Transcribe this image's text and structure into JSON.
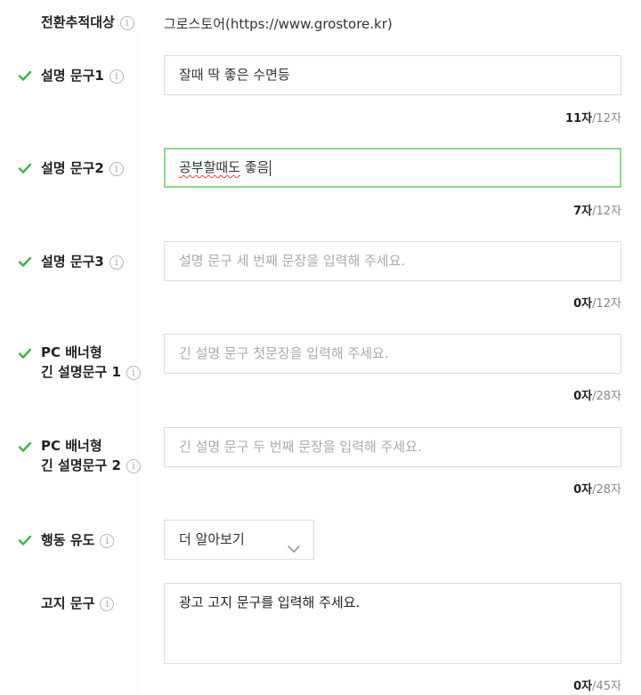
{
  "conversion": {
    "label": "전환추적대상",
    "value": "그로스토어(https://www.grostore.kr)"
  },
  "desc1": {
    "label": "설명 문구1",
    "value": "잘때 딱 좋은 수면등",
    "counter_current": "11자",
    "counter_max": "/12자"
  },
  "desc2": {
    "label": "설명 문구2",
    "value_part1": "공부할때도",
    "value_part2": " 좋음",
    "counter_current": "7자",
    "counter_max": "/12자"
  },
  "desc3": {
    "label": "설명 문구3",
    "placeholder": "설명 문구 세 번째 문장을 입력해 주세요.",
    "counter_current": "0자",
    "counter_max": "/12자"
  },
  "pc_long1": {
    "label_line1": "PC 배너형",
    "label_line2": "긴 설명문구 1",
    "placeholder": "긴 설명 문구 첫문장을 입력해 주세요.",
    "counter_current": "0자",
    "counter_max": "/28자"
  },
  "pc_long2": {
    "label_line1": "PC 배너형",
    "label_line2": "긴 설명문구 2",
    "placeholder": "긴 설명 문구 두 번째 문장을 입력해 주세요.",
    "counter_current": "0자",
    "counter_max": "/28자"
  },
  "cta": {
    "label": "행동 유도",
    "selected": "더 알아보기"
  },
  "notice": {
    "label": "고지 문구",
    "placeholder": "광고 고지 문구를 입력해 주세요.",
    "counter_current": "0자",
    "counter_max": "/45자"
  },
  "icons": {
    "check": "check-icon",
    "info": "info-icon",
    "chevron": "chevron-down-icon"
  },
  "colors": {
    "check": "#3eb34d",
    "focus_border": "#8ed88c",
    "spell_error": "#e3463c"
  }
}
